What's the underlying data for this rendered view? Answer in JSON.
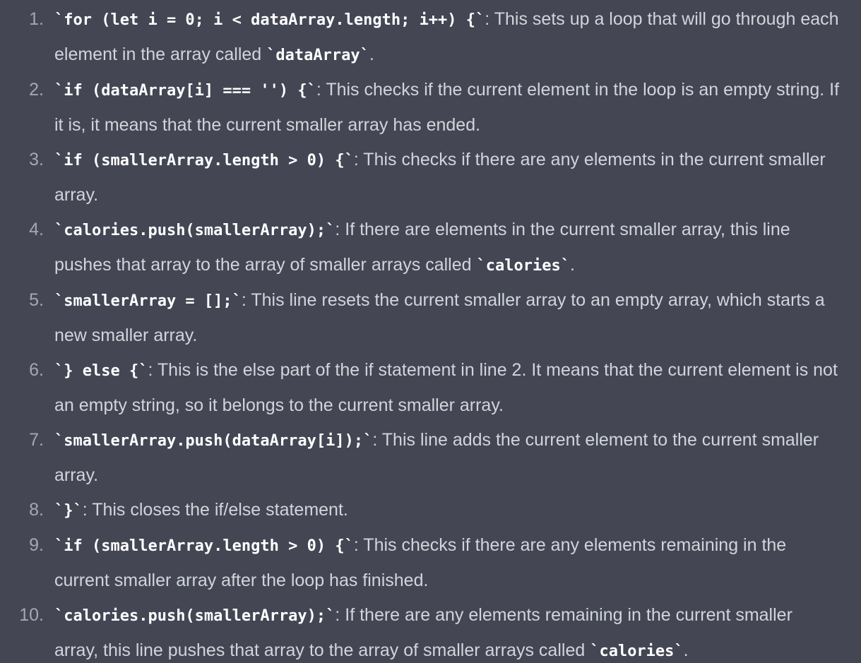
{
  "steps": [
    {
      "num": "1.",
      "code": "for (let i = 0; i < dataArray.length; i++) {",
      "text": ": This sets up a loop that will go through each element in the array called ",
      "code2": "dataArray",
      "end": "."
    },
    {
      "num": "2.",
      "code": "if (dataArray[i] === '') {",
      "text": ": This checks if the current element in the loop is an empty string. If it is, it means that the current smaller array has ended.",
      "code2": "",
      "end": ""
    },
    {
      "num": "3.",
      "code": "if (smallerArray.length > 0) {",
      "text": ": This checks if there are any elements in the current smaller array.",
      "code2": "",
      "end": ""
    },
    {
      "num": "4.",
      "code": "calories.push(smallerArray);",
      "text": ": If there are elements in the current smaller array, this line pushes that array to the array of smaller arrays called ",
      "code2": "calories",
      "end": "."
    },
    {
      "num": "5.",
      "code": "smallerArray = [];",
      "text": ": This line resets the current smaller array to an empty array, which starts a new smaller array.",
      "code2": "",
      "end": ""
    },
    {
      "num": "6.",
      "code": "} else {",
      "text": ": This is the else part of the if statement in line 2. It means that the current element is not an empty string, so it belongs to the current smaller array.",
      "code2": "",
      "end": ""
    },
    {
      "num": "7.",
      "code": "smallerArray.push(dataArray[i]);",
      "text": ": This line adds the current element to the current smaller array.",
      "code2": "",
      "end": ""
    },
    {
      "num": "8.",
      "code": "}",
      "text": ": This closes the if/else statement.",
      "code2": "",
      "end": ""
    },
    {
      "num": "9.",
      "code": "if (smallerArray.length > 0) {",
      "text": ": This checks if there are any elements remaining in the current smaller array after the loop has finished.",
      "code2": "",
      "end": ""
    },
    {
      "num": "10.",
      "code": "calories.push(smallerArray);",
      "text": ": If there are any elements remaining in the current smaller array, this line pushes that array to the array of smaller arrays called ",
      "code2": "calories",
      "end": "."
    }
  ],
  "colors": {
    "background": "#444654",
    "text": "#d1d5db",
    "code": "#ffffff",
    "number": "#a4a8b2"
  }
}
